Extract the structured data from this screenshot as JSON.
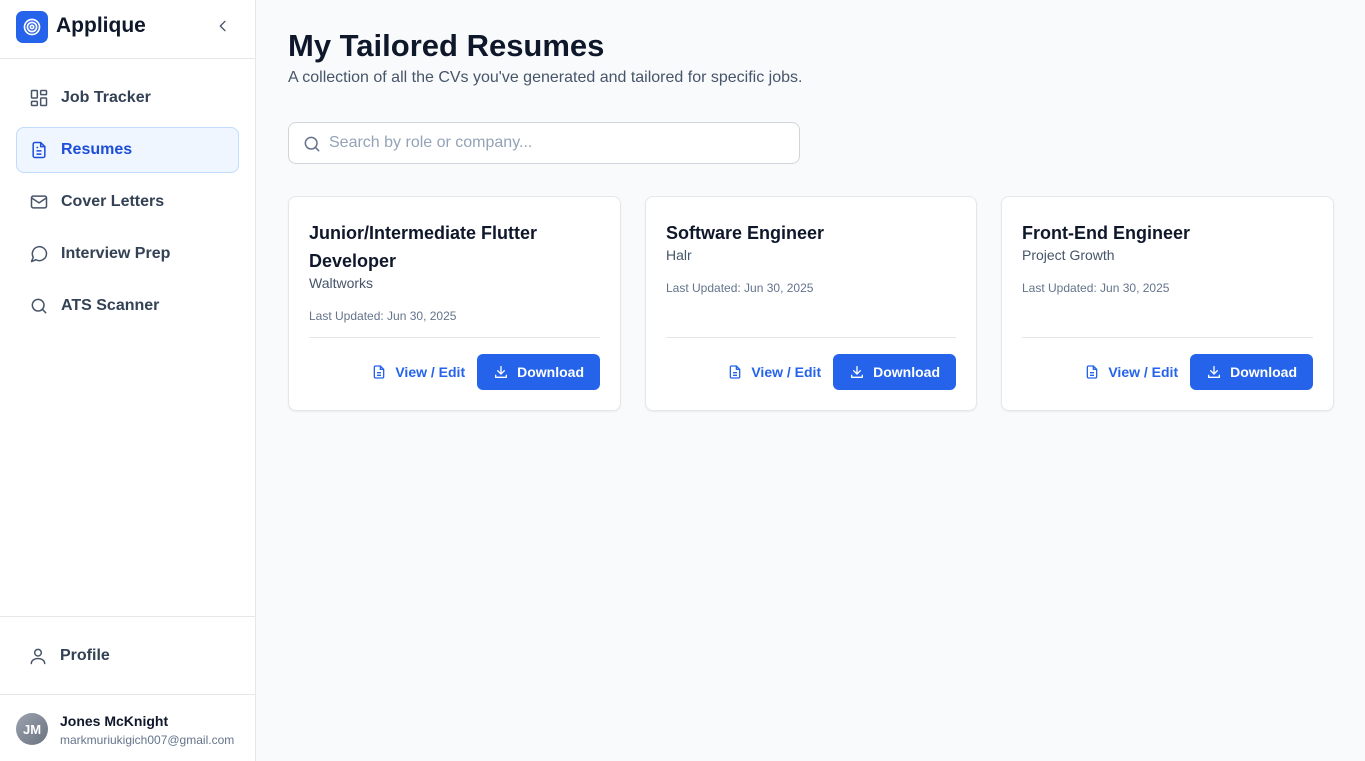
{
  "app": {
    "name": "Applique",
    "logo_icon": "target-icon",
    "accent_color": "#2563eb"
  },
  "sidebar": {
    "items": [
      {
        "label": "Job Tracker",
        "icon": "layout-grid-icon",
        "active": false
      },
      {
        "label": "Resumes",
        "icon": "file-text-icon",
        "active": true
      },
      {
        "label": "Cover Letters",
        "icon": "mail-icon",
        "active": false
      },
      {
        "label": "Interview Prep",
        "icon": "message-circle-icon",
        "active": false
      },
      {
        "label": "ATS Scanner",
        "icon": "search-icon",
        "active": false
      }
    ],
    "profile_label": "Profile",
    "user": {
      "initials": "JM",
      "name": "Jones McKnight",
      "email": "markmuriukigich007@gmail.com"
    }
  },
  "main": {
    "title": "My Tailored Resumes",
    "subtitle": "A collection of all the CVs you've generated and tailored for specific jobs.",
    "search": {
      "placeholder": "Search by role or company...",
      "value": ""
    },
    "view_edit_label": "View / Edit",
    "download_label": "Download",
    "cards": [
      {
        "title": "Junior/Intermediate Flutter Developer",
        "company": "Waltworks",
        "updated": "Last Updated: Jun 30, 2025"
      },
      {
        "title": "Software Engineer",
        "company": "Halr",
        "updated": "Last Updated: Jun 30, 2025"
      },
      {
        "title": "Front-End Engineer",
        "company": "Project Growth",
        "updated": "Last Updated: Jun 30, 2025"
      }
    ]
  }
}
